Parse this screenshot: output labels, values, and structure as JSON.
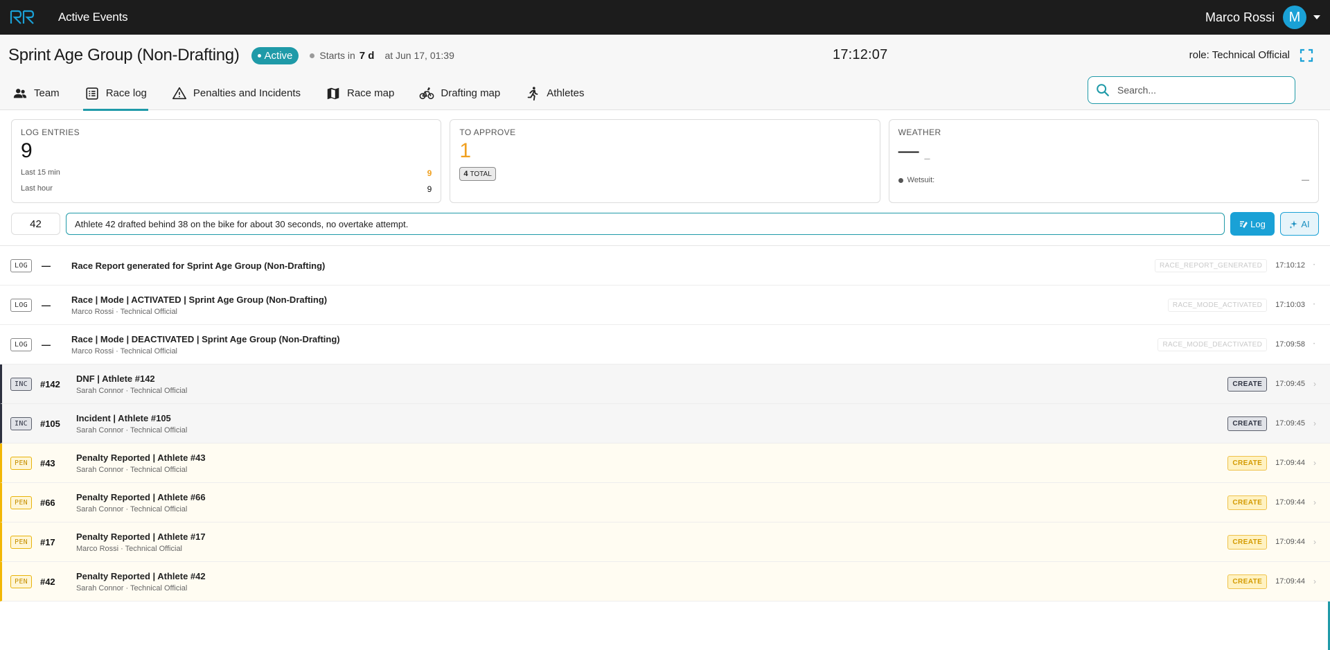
{
  "app": {
    "title": "Active Events"
  },
  "user": {
    "name": "Marco Rossi",
    "initial": "M"
  },
  "event": {
    "title": "Sprint Age Group (Non-Drafting)",
    "status": "Active",
    "starts_label": "Starts in",
    "starts_value": "7 d",
    "starts_at": "at Jun 17, 01:39",
    "clock": "17:12:07",
    "role": "role: Technical Official"
  },
  "tabs": [
    {
      "label": "Team",
      "icon": "people-icon"
    },
    {
      "label": "Race log",
      "icon": "list-icon",
      "active": true
    },
    {
      "label": "Penalties and Incidents",
      "icon": "warning-icon"
    },
    {
      "label": "Race map",
      "icon": "map-icon"
    },
    {
      "label": "Drafting map",
      "icon": "bike-icon"
    },
    {
      "label": "Athletes",
      "icon": "runner-icon"
    }
  ],
  "search": {
    "placeholder": "Search..."
  },
  "cards": {
    "log_entries": {
      "label": "LOG ENTRIES",
      "value": "9",
      "last15_label": "Last 15 min",
      "last15_value": "9",
      "lasthour_label": "Last hour",
      "lasthour_value": "9"
    },
    "to_approve": {
      "label": "TO APPROVE",
      "value": "1",
      "total_num": "4",
      "total_label": "TOTAL"
    },
    "weather": {
      "label": "WEATHER",
      "value": "—",
      "unit": "_",
      "wetsuit_label": "Wetsuit:",
      "wetsuit_value": "—"
    }
  },
  "entry": {
    "athlete_value": "42",
    "note_value": "Athlete 42 drafted behind 38 on the bike for about 30 seconds, no overtake attempt.",
    "log_label": "Log",
    "ai_label": "AI"
  },
  "colors": {
    "accent": "#1f9aa8",
    "brand_blue": "#1aa1d6",
    "penalty": "#f2b705",
    "incident": "#2d3140",
    "topbar": "#1c1c1c"
  },
  "log": [
    {
      "kind": "log",
      "chip": "LOG",
      "id": "—",
      "title": "Race Report generated for Sprint Age Group (Non-Drafting)",
      "sub": "",
      "code": "RACE_REPORT_GENERATED",
      "time": "17:10:12"
    },
    {
      "kind": "log",
      "chip": "LOG",
      "id": "—",
      "title": "Race | Mode | ACTIVATED | Sprint Age Group (Non-Drafting)",
      "sub": "Marco Rossi · Technical Official",
      "code": "RACE_MODE_ACTIVATED",
      "time": "17:10:03"
    },
    {
      "kind": "log",
      "chip": "LOG",
      "id": "—",
      "title": "Race | Mode | DEACTIVATED | Sprint Age Group (Non-Drafting)",
      "sub": "Marco Rossi · Technical Official",
      "code": "RACE_MODE_DEACTIVATED",
      "time": "17:09:58"
    },
    {
      "kind": "inc",
      "chip": "INC",
      "id": "#142",
      "title": "DNF | Athlete #142",
      "sub": "Sarah Connor · Technical Official",
      "code": "CREATE",
      "time": "17:09:45"
    },
    {
      "kind": "inc",
      "chip": "INC",
      "id": "#105",
      "title": "Incident | Athlete #105",
      "sub": "Sarah Connor · Technical Official",
      "code": "CREATE",
      "time": "17:09:45"
    },
    {
      "kind": "pen",
      "chip": "PEN",
      "id": "#43",
      "title": "Penalty Reported | Athlete #43",
      "sub": "Sarah Connor · Technical Official",
      "code": "CREATE",
      "time": "17:09:44"
    },
    {
      "kind": "pen",
      "chip": "PEN",
      "id": "#66",
      "title": "Penalty Reported | Athlete #66",
      "sub": "Sarah Connor · Technical Official",
      "code": "CREATE",
      "time": "17:09:44"
    },
    {
      "kind": "pen",
      "chip": "PEN",
      "id": "#17",
      "title": "Penalty Reported | Athlete #17",
      "sub": "Marco Rossi · Technical Official",
      "code": "CREATE",
      "time": "17:09:44"
    },
    {
      "kind": "pen",
      "chip": "PEN",
      "id": "#42",
      "title": "Penalty Reported | Athlete #42",
      "sub": "Sarah Connor · Technical Official",
      "code": "CREATE",
      "time": "17:09:44"
    }
  ]
}
